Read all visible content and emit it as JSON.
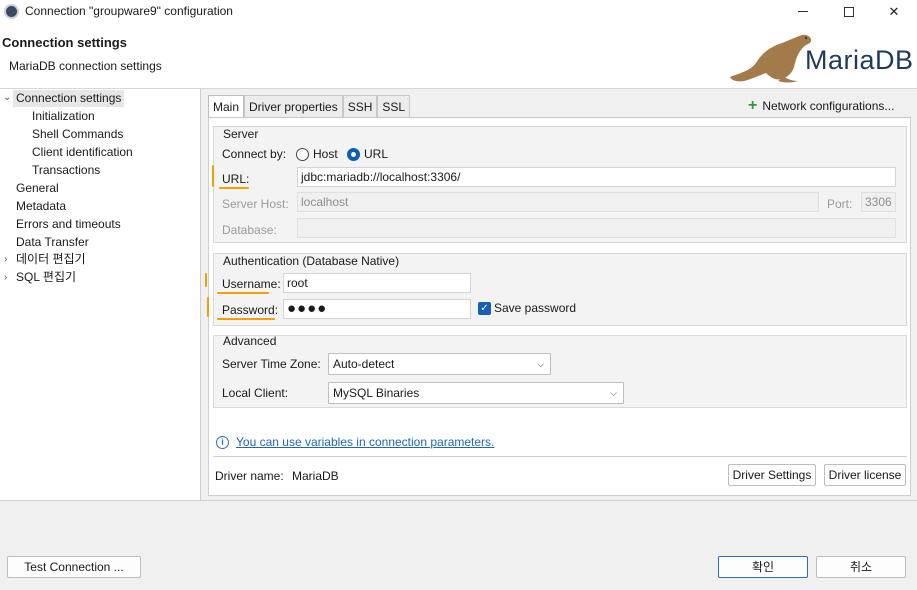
{
  "window": {
    "title": "Connection \"groupware9\" configuration",
    "min_icon": "minimize-icon",
    "max_icon": "maximize-icon",
    "close_glyph": "✕"
  },
  "header": {
    "title": "Connection settings",
    "subtitle": "MariaDB connection settings",
    "logo_text": "MariaDB"
  },
  "tree": {
    "items": [
      {
        "label": "Connection settings",
        "arrow": "⌄"
      },
      {
        "label": "Initialization"
      },
      {
        "label": "Shell Commands"
      },
      {
        "label": "Client identification"
      },
      {
        "label": "Transactions"
      },
      {
        "label": "General"
      },
      {
        "label": "Metadata"
      },
      {
        "label": "Errors and timeouts"
      },
      {
        "label": "Data Transfer"
      },
      {
        "label": "데이터 편집기",
        "arrow": "›"
      },
      {
        "label": "SQL 편집기",
        "arrow": "›"
      }
    ]
  },
  "tabs": [
    {
      "label": "Main"
    },
    {
      "label": "Driver properties"
    },
    {
      "label": "SSH"
    },
    {
      "label": "SSL"
    }
  ],
  "network_config": {
    "icon": "+",
    "label": "Network configurations..."
  },
  "server": {
    "title": "Server",
    "connect_by_label": "Connect by:",
    "option_host": "Host",
    "option_url": "URL",
    "url_label": "URL:",
    "url_value": "jdbc:mariadb://localhost:3306/",
    "host_label": "Server Host:",
    "host_value": "localhost",
    "port_label": "Port:",
    "port_value": "3306",
    "database_label": "Database:",
    "database_value": ""
  },
  "auth": {
    "title": "Authentication (Database Native)",
    "username_label": "Username:",
    "username_value": "root",
    "password_label": "Password:",
    "password_value": "●●●●",
    "save_password_label": "Save password",
    "check_glyph": "✓"
  },
  "advanced": {
    "title": "Advanced",
    "timezone_label": "Server Time Zone:",
    "timezone_value": "Auto-detect",
    "client_label": "Local Client:",
    "client_value": "MySQL Binaries",
    "chevron": "⌵"
  },
  "info": {
    "icon": "i",
    "link": "You can use variables in connection parameters."
  },
  "driver": {
    "name_label": "Driver name:",
    "name_value": "MariaDB",
    "settings_button": "Driver Settings",
    "license_button": "Driver license"
  },
  "footer": {
    "test_button": "Test Connection ...",
    "ok_button": "확인",
    "cancel_button": "취소"
  },
  "colors": {
    "accent": "#0a5fb4",
    "annotation": "#f0a000",
    "link": "#1f66b3",
    "plus": "#2f9a3a"
  }
}
